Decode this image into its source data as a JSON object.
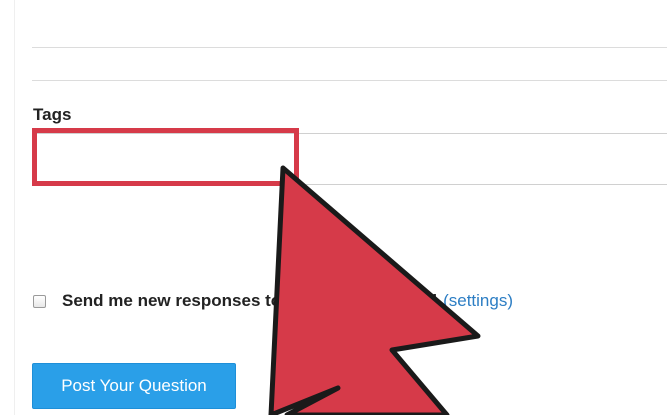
{
  "form": {
    "tags_label": "Tags",
    "tags_value": "",
    "notify_text": "Send me new responses to my posts via email",
    "notify_checked": false,
    "settings_link": "(settings)",
    "submit_label": "Post Your Question"
  },
  "annotation": {
    "highlight_color": "#d63a49",
    "pointer": "arrow-cursor-icon",
    "pointer_color": "#d63a49"
  },
  "colors": {
    "button_bg": "#2a9fe8",
    "link": "#2d7ec4"
  }
}
